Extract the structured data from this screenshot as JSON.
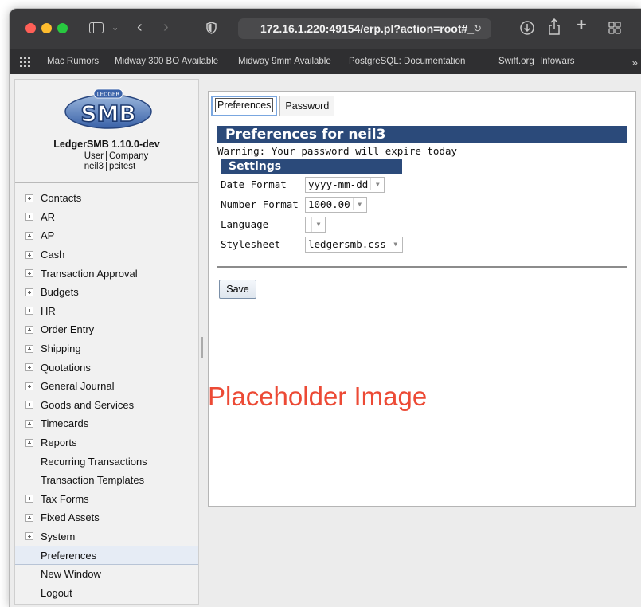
{
  "browser": {
    "url": "172.16.1.220:49154/erp.pl?action=root#_",
    "bookmarks": [
      "Mac Rumors",
      "Midway 300 BO Available",
      "Midway 9mm Available",
      "PostgreSQL: Documentation",
      "Swift.org",
      "Infowars"
    ],
    "more": "»"
  },
  "sidebar": {
    "logo_top": "LEDGER",
    "logo_main": "SMB",
    "app_name": "LedgerSMB 1.10.0-dev",
    "user_label": "User",
    "company_label": "Company",
    "user_value": "neil3",
    "company_value": "pcitest",
    "items": [
      {
        "label": "Contacts",
        "expandable": true
      },
      {
        "label": "AR",
        "expandable": true
      },
      {
        "label": "AP",
        "expandable": true
      },
      {
        "label": "Cash",
        "expandable": true
      },
      {
        "label": "Transaction Approval",
        "expandable": true
      },
      {
        "label": "Budgets",
        "expandable": true
      },
      {
        "label": "HR",
        "expandable": true
      },
      {
        "label": "Order Entry",
        "expandable": true
      },
      {
        "label": "Shipping",
        "expandable": true
      },
      {
        "label": "Quotations",
        "expandable": true
      },
      {
        "label": "General Journal",
        "expandable": true
      },
      {
        "label": "Goods and Services",
        "expandable": true
      },
      {
        "label": "Timecards",
        "expandable": true
      },
      {
        "label": "Reports",
        "expandable": true
      },
      {
        "label": "Recurring Transactions",
        "expandable": false
      },
      {
        "label": "Transaction Templates",
        "expandable": false
      },
      {
        "label": "Tax Forms",
        "expandable": true
      },
      {
        "label": "Fixed Assets",
        "expandable": true
      },
      {
        "label": "System",
        "expandable": true
      },
      {
        "label": "Preferences",
        "expandable": false,
        "active": true
      },
      {
        "label": "New Window",
        "expandable": false
      },
      {
        "label": "Logout",
        "expandable": false
      }
    ]
  },
  "tabs": [
    {
      "label": "Preferences",
      "selected": true
    },
    {
      "label": "Password",
      "selected": false
    }
  ],
  "main": {
    "heading": "Preferences for neil3",
    "warning": "Warning: Your password will expire today",
    "settings_heading": "Settings",
    "fields": [
      {
        "label": "Date Format",
        "value": "yyyy-mm-dd"
      },
      {
        "label": "Number Format",
        "value": "1000.00"
      },
      {
        "label": "Language",
        "value": ""
      },
      {
        "label": "Stylesheet",
        "value": "ledgersmb.css"
      }
    ],
    "save_label": "Save"
  },
  "overlay_text": "Placeholder Image",
  "colors": {
    "header_bar": "#2b4a7a",
    "placeholder_text": "#ec4a35",
    "traffic_red": "#ff5f57",
    "traffic_yellow": "#febc2e",
    "traffic_green": "#28c840"
  }
}
